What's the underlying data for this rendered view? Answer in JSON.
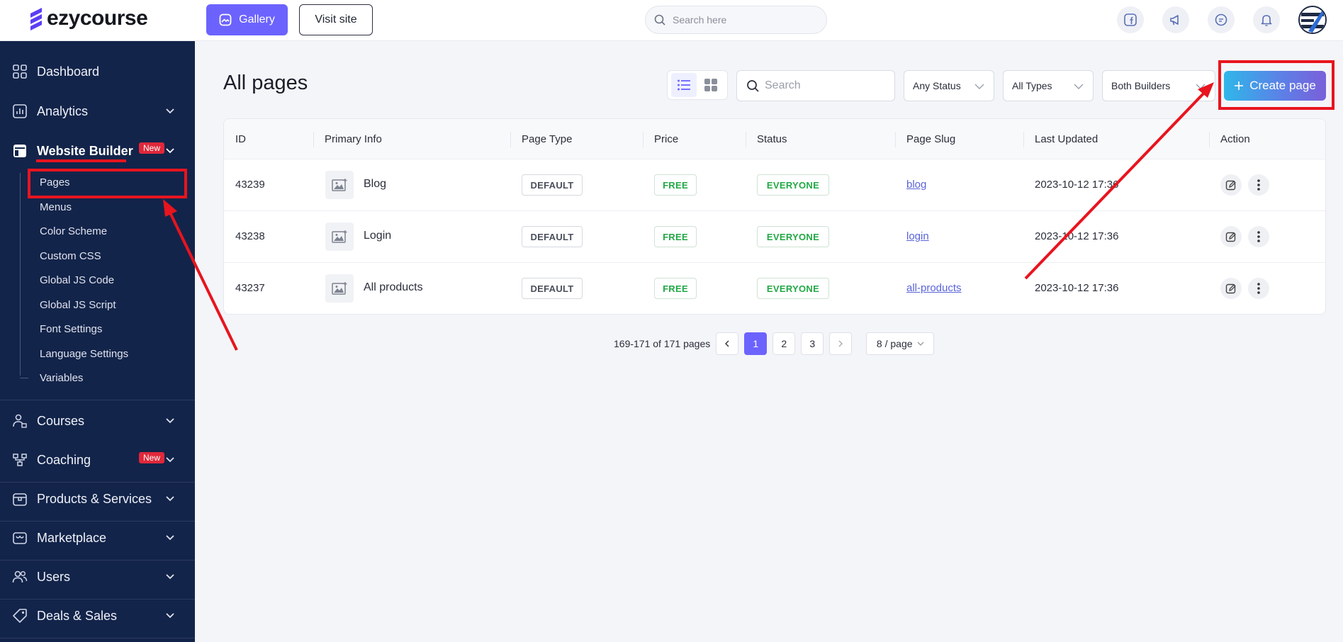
{
  "brand": {
    "name": "ezycourse",
    "accent": "#6c63ff",
    "sidebar_bg": "#13244a"
  },
  "topbar": {
    "gallery_label": "Gallery",
    "visit_site_label": "Visit site",
    "search_placeholder": "Search here",
    "icons": [
      "facebook-icon",
      "megaphone-icon",
      "chat-icon",
      "bell-icon"
    ]
  },
  "sidebar": {
    "items": [
      {
        "label": "Dashboard",
        "icon": "dashboard-icon"
      },
      {
        "label": "Analytics",
        "icon": "analytics-icon"
      },
      {
        "label": "Website Builder",
        "icon": "website-builder-icon",
        "badge": "New"
      },
      {
        "label": "Courses",
        "icon": "courses-icon"
      },
      {
        "label": "Coaching",
        "icon": "coaching-icon",
        "badge": "New"
      },
      {
        "label": "Products & Services",
        "icon": "box-icon"
      },
      {
        "label": "Marketplace",
        "icon": "store-icon"
      },
      {
        "label": "Users",
        "icon": "users-icon"
      },
      {
        "label": "Deals & Sales",
        "icon": "tag-icon"
      }
    ],
    "sub_items": [
      "Pages",
      "Menus",
      "Color Scheme",
      "Custom CSS",
      "Global JS Code",
      "Global JS Script",
      "Font Settings",
      "Language Settings",
      "Variables"
    ]
  },
  "main": {
    "title": "All pages",
    "search_placeholder": "Search",
    "filters": {
      "status": "Any Status",
      "types": "All Types",
      "builders": "Both Builders"
    },
    "create_label": "Create page",
    "table": {
      "columns": [
        "ID",
        "Primary Info",
        "Page Type",
        "Price",
        "Status",
        "Page Slug",
        "Last Updated",
        "Action"
      ],
      "rows": [
        {
          "id": "43239",
          "name": "Blog",
          "type": "DEFAULT",
          "price": "FREE",
          "status": "EVERYONE",
          "slug": "blog",
          "updated": "2023-10-12 17:36"
        },
        {
          "id": "43238",
          "name": "Login",
          "type": "DEFAULT",
          "price": "FREE",
          "status": "EVERYONE",
          "slug": "login",
          "updated": "2023-10-12 17:36"
        },
        {
          "id": "43237",
          "name": "All products",
          "type": "DEFAULT",
          "price": "FREE",
          "status": "EVERYONE",
          "slug": "all-products",
          "updated": "2023-10-12 17:36"
        }
      ]
    },
    "pagination": {
      "total": "169-171 of 171 pages",
      "pages": [
        "1",
        "2",
        "3"
      ],
      "current": "1",
      "page_size": "8 / page"
    }
  },
  "annotations": {
    "color": "#e8141e"
  }
}
